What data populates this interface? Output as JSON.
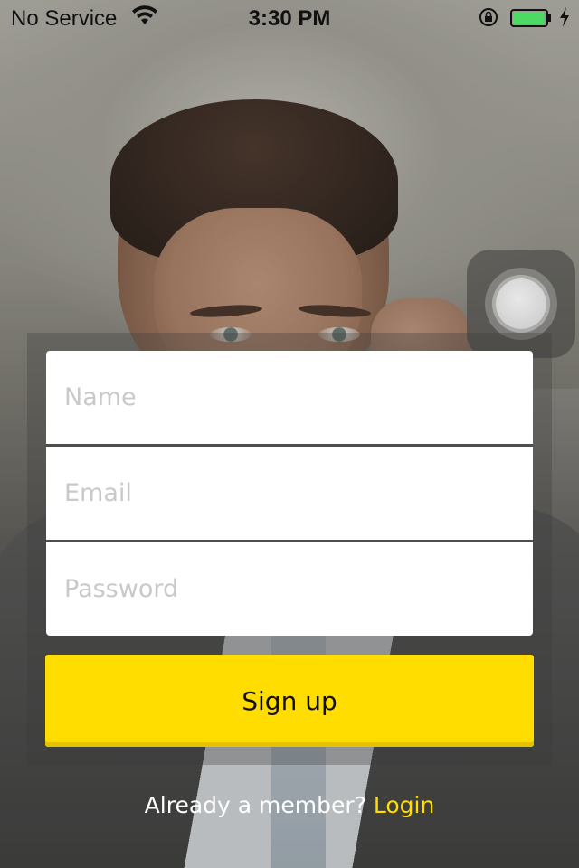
{
  "status_bar": {
    "carrier": "No Service",
    "time": "3:30 PM",
    "icons": [
      "wifi-icon",
      "orientation-lock-icon",
      "battery-icon",
      "charging-bolt-icon"
    ],
    "battery_color": "#4cd964",
    "battery_level": 0.95
  },
  "form": {
    "name_placeholder": "Name",
    "email_placeholder": "Email",
    "password_placeholder": "Password",
    "signup_label": "Sign up"
  },
  "footer": {
    "member_text": "Already a member?",
    "login_label": "Login"
  },
  "colors": {
    "accent": "#ffdd00",
    "field_background": "#ffffff",
    "placeholder": "#c9c9c9"
  }
}
